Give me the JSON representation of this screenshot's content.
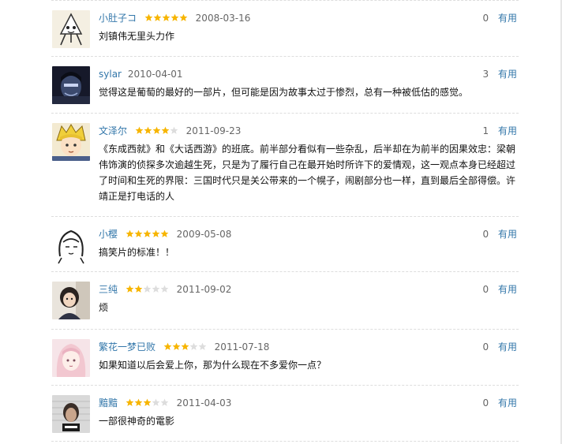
{
  "colors": {
    "link": "#3377aa",
    "star_on": "#f7b500",
    "star_off": "#dddddd",
    "divider": "#dddddd"
  },
  "comments": [
    {
      "user": "小肚子コ",
      "rating": 5,
      "date": "2008-03-16",
      "useful_count": "0",
      "useful_label": "有用",
      "text": "刘镇伟无里头力作",
      "avatar": "cartoon-character-avatar"
    },
    {
      "user": "sylar",
      "rating": 0,
      "date": "2010-04-01",
      "useful_count": "3",
      "useful_label": "有用",
      "text": "觉得这是葡萄的最好的一部片，但可能是因为故事太过于惨烈，总有一种被低估的感觉。",
      "avatar": "villain-portrait-avatar"
    },
    {
      "user": "文泽尔",
      "rating": 4,
      "date": "2011-09-23",
      "useful_count": "1",
      "useful_label": "有用",
      "text": "《东成西就》和《大话西游》的班底。前半部分看似有一些杂乱，后半却在为前半的因果效忠：梁朝伟饰演的侦探多次逾越生死，只是为了履行自己在最开始时所许下的爱情观，这一观点本身已经超过了时间和生死的界限：三国时代只是关公带来的一个幌子，闹剧部分也一样，直到最后全部得偿。许靖正是打电话的人",
      "avatar": "anime-blond-boy-avatar"
    },
    {
      "user": "小樱",
      "rating": 5,
      "date": "2009-05-08",
      "useful_count": "0",
      "useful_label": "有用",
      "text": "搞笑片的标准！！",
      "avatar": "sketch-girl-avatar"
    },
    {
      "user": "三纯",
      "rating": 2,
      "date": "2011-09-02",
      "useful_count": "0",
      "useful_label": "有用",
      "text": "烦",
      "avatar": "photo-girl-avatar"
    },
    {
      "user": "繁花一梦已败",
      "rating": 3,
      "date": "2011-07-18",
      "useful_count": "0",
      "useful_label": "有用",
      "text": "如果知道以后会爱上你，那为什么现在不多爱你一点？",
      "avatar": "pink-anime-avatar"
    },
    {
      "user": "黯黯",
      "rating": 3,
      "date": "2011-04-03",
      "useful_count": "0",
      "useful_label": "有用",
      "text": "一部很神奇的電影",
      "avatar": "mugshot-avatar"
    }
  ]
}
